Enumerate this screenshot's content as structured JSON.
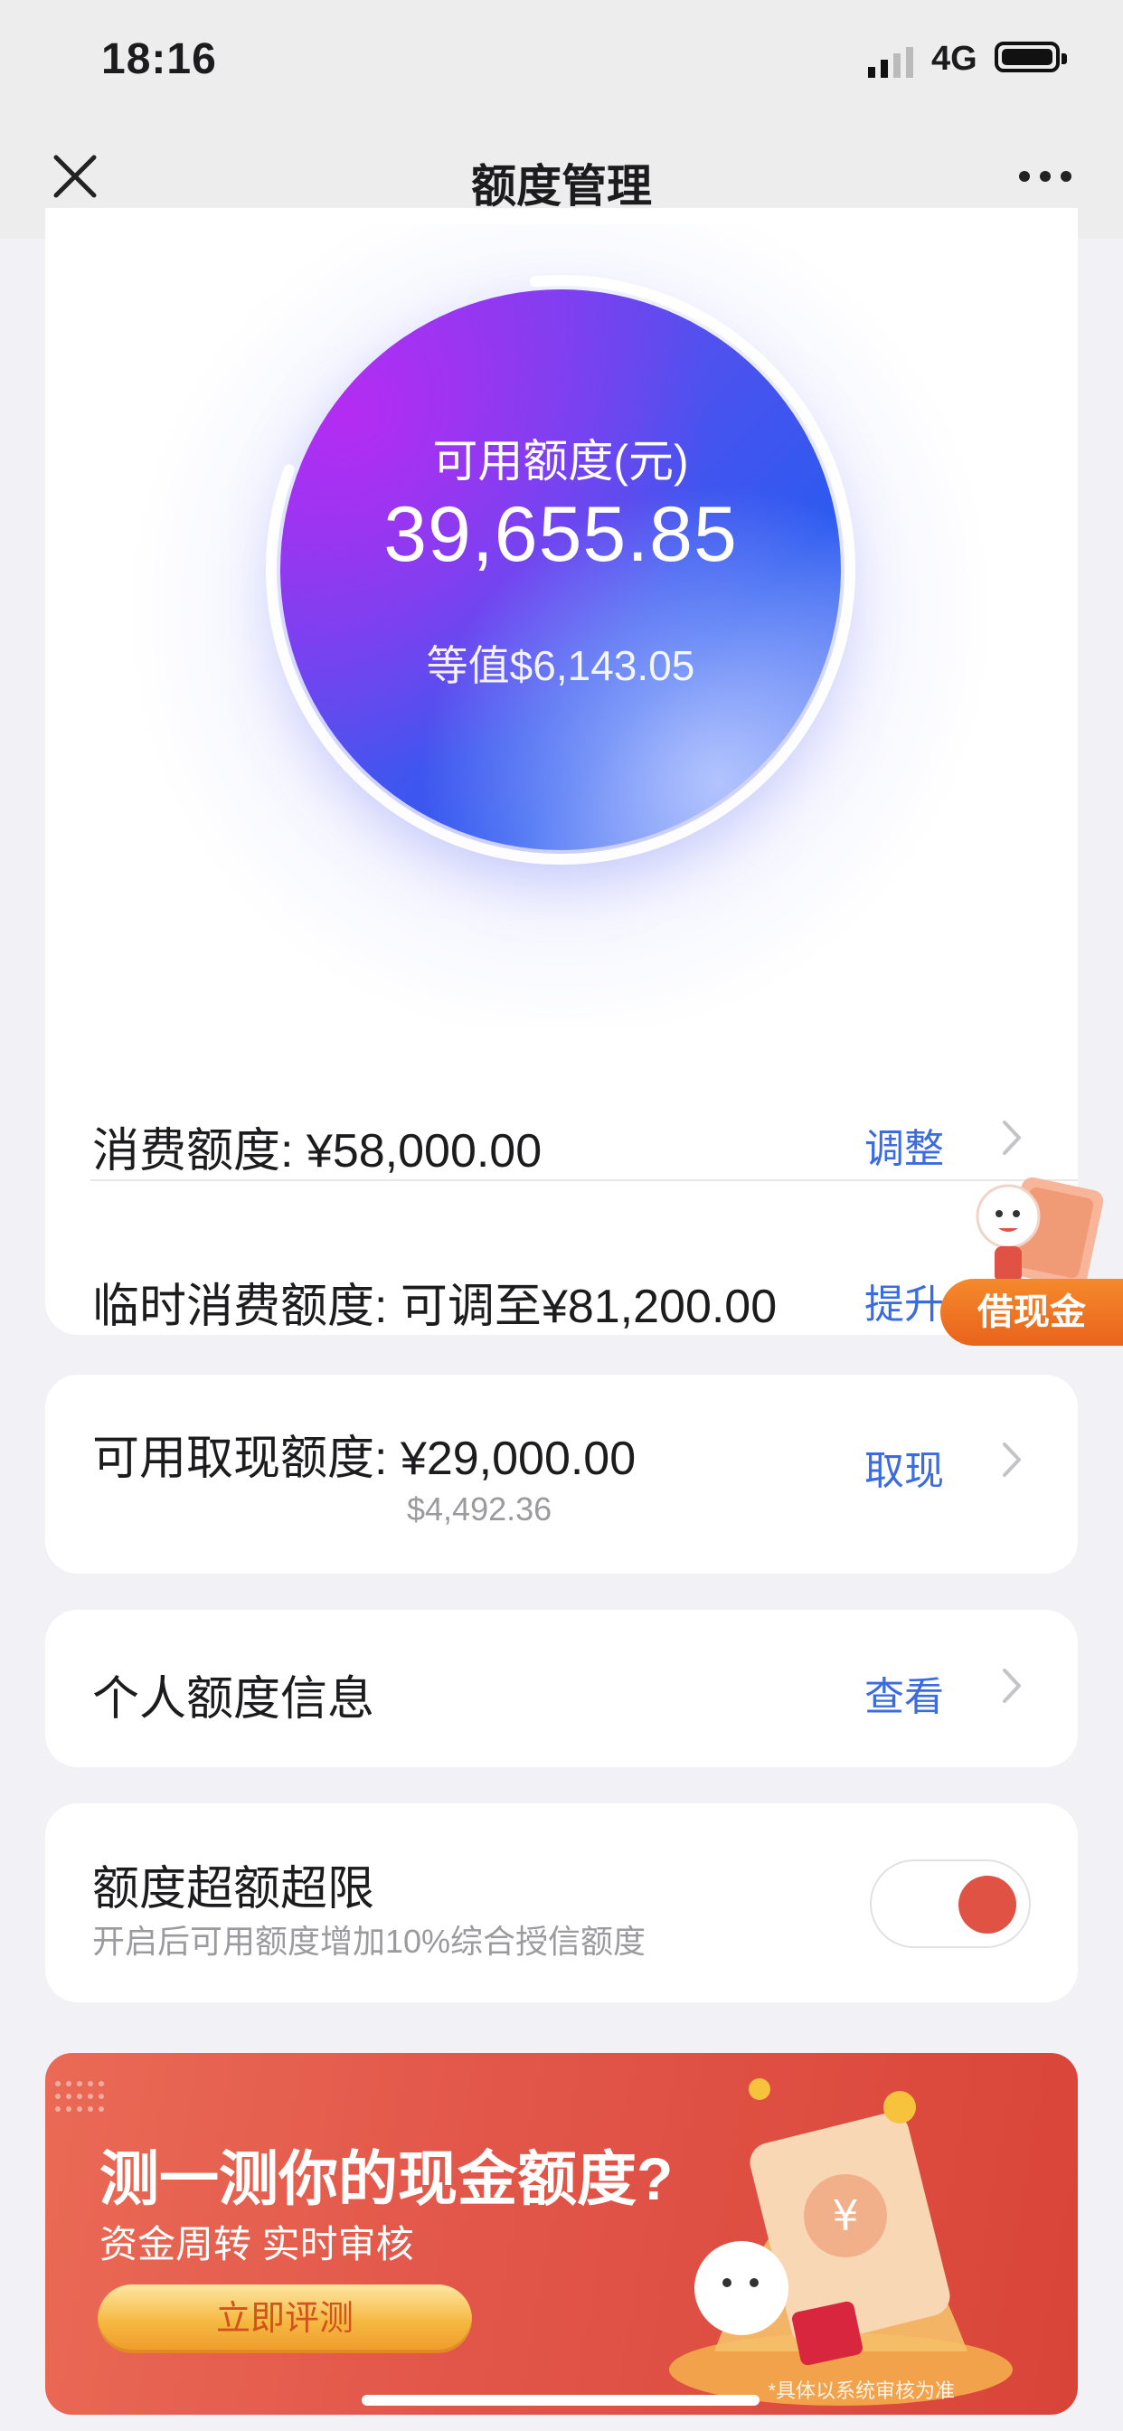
{
  "status_bar": {
    "time": "18:16",
    "network": "4G"
  },
  "nav": {
    "title": "额度管理"
  },
  "credit": {
    "label": "可用额度(元)",
    "amount": "39,655.85",
    "equivalent": "等值$6,143.05",
    "ring_progress": 0.82
  },
  "rows": {
    "consumption": {
      "label": "消费额度: ¥58,000.00",
      "action": "调整"
    },
    "temporary": {
      "label": "临时消费额度: 可调至¥81,200.00",
      "action": "提升"
    },
    "cash": {
      "label": "可用取现额度: ¥29,000.00",
      "sub": "$4,492.36",
      "action": "取现"
    },
    "personal": {
      "label": "个人额度信息",
      "action": "查看"
    },
    "overlimit": {
      "label": "额度超额超限",
      "sub": "开启后可用额度增加10%综合授信额度",
      "enabled": true
    }
  },
  "float_badge": {
    "label": "借现金"
  },
  "banner": {
    "title": "测一测你的现金额度?",
    "subtitle": "资金周转 实时审核",
    "cta": "立即评测",
    "note": "*具体以系统审核为准"
  },
  "colors": {
    "accent": "#3b6be0",
    "toggle_knob": "#e05244",
    "banner": "#e2574a"
  }
}
